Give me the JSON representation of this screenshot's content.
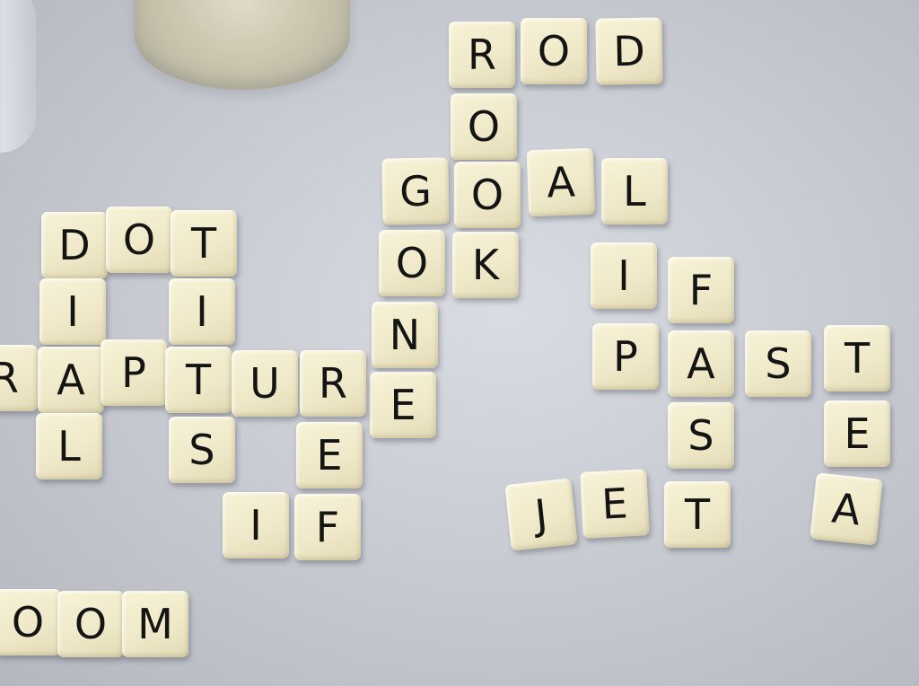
{
  "tiles": [
    {
      "letter": "R"
    },
    {
      "letter": "O"
    },
    {
      "letter": "D"
    },
    {
      "letter": "O"
    },
    {
      "letter": "G"
    },
    {
      "letter": "O"
    },
    {
      "letter": "A"
    },
    {
      "letter": "L"
    },
    {
      "letter": "O"
    },
    {
      "letter": "K"
    },
    {
      "letter": "N"
    },
    {
      "letter": "E"
    },
    {
      "letter": "D"
    },
    {
      "letter": "O"
    },
    {
      "letter": "T"
    },
    {
      "letter": "I"
    },
    {
      "letter": "I"
    },
    {
      "letter": "R"
    },
    {
      "letter": "A"
    },
    {
      "letter": "P"
    },
    {
      "letter": "T"
    },
    {
      "letter": "U"
    },
    {
      "letter": "R"
    },
    {
      "letter": "L"
    },
    {
      "letter": "S"
    },
    {
      "letter": "E"
    },
    {
      "letter": "I"
    },
    {
      "letter": "F"
    },
    {
      "letter": "I"
    },
    {
      "letter": "F"
    },
    {
      "letter": "P"
    },
    {
      "letter": "A"
    },
    {
      "letter": "S"
    },
    {
      "letter": "T"
    },
    {
      "letter": "S"
    },
    {
      "letter": "E"
    },
    {
      "letter": "J"
    },
    {
      "letter": "E"
    },
    {
      "letter": "T"
    },
    {
      "letter": "A"
    },
    {
      "letter": "O"
    },
    {
      "letter": "O"
    },
    {
      "letter": "M"
    }
  ]
}
